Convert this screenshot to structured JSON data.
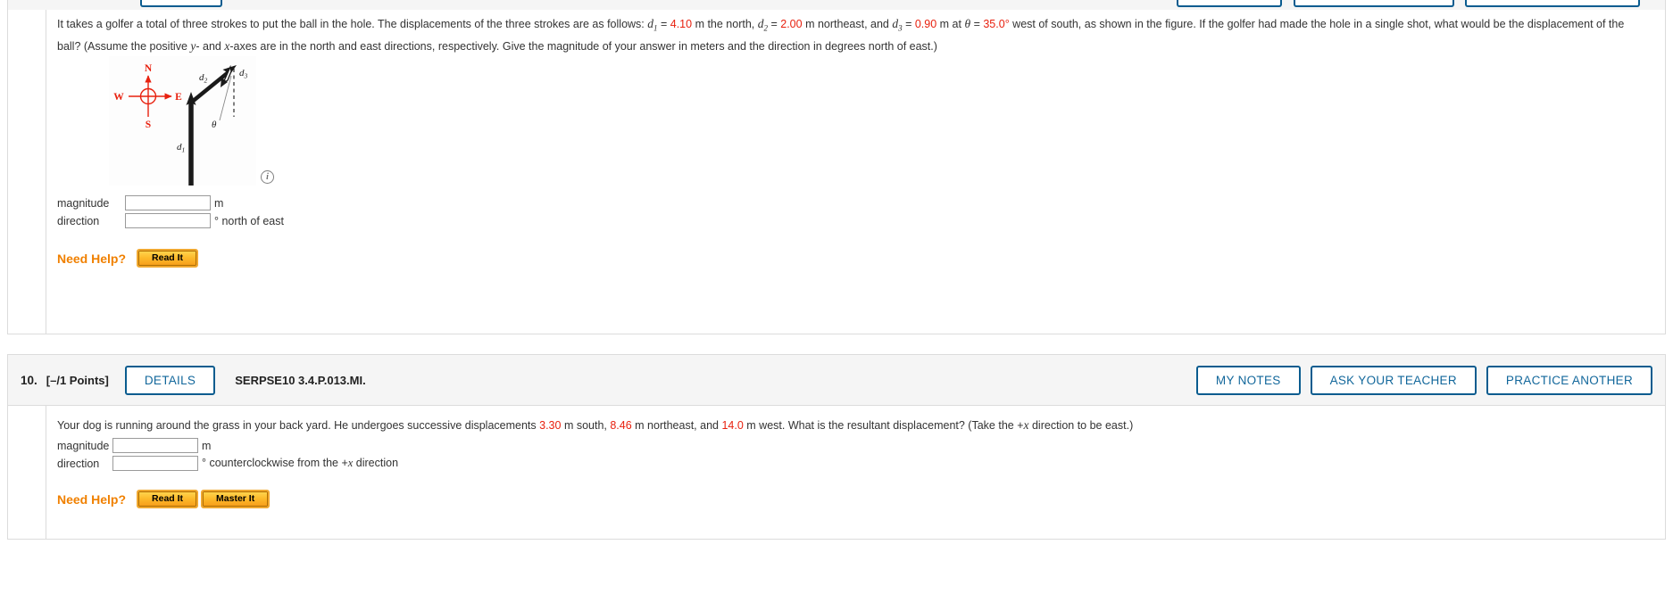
{
  "q9": {
    "problem_text_part1": "It takes a golfer a total of three strokes to put the ball in the hole. The displacements of the three strokes are as follows: ",
    "d1_sym": "d",
    "d1_sub": "1",
    "d1_val": "4.10",
    "after_d1": " m the north, ",
    "d2_sym": "d",
    "d2_sub": "2",
    "d2_val": "2.00",
    "after_d2": " m northeast, and ",
    "d3_sym": "d",
    "d3_sub": "3",
    "d3_val": "0.90",
    "after_d3": " m at ",
    "theta_sym": "θ",
    "theta_eq": " = ",
    "theta_val": "35.0°",
    "after_theta": " west of south, as shown in the figure. If the golfer had made the hole in a single shot, what would be the displacement of the ball? (Assume the positive ",
    "axis_y": "y",
    "axis_mid": "- and ",
    "axis_x": "x",
    "tail": "-axes are in the north and east directions, respectively. Give the magnitude of your answer in meters and the direction in degrees north of east.)",
    "figure": {
      "compass_n": "N",
      "compass_s": "S",
      "compass_e": "E",
      "compass_w": "W",
      "label_d1": "d",
      "label_d1_sub": "1",
      "label_d2": "d",
      "label_d2_sub": "2",
      "label_d3": "d",
      "label_d3_sub": "3",
      "label_theta": "θ",
      "compass_color": "#e8210f",
      "vector_color": "#1a1a1a"
    },
    "info_icon_glyph": "i",
    "answers": [
      {
        "label": "magnitude",
        "value": "",
        "unit": "m"
      },
      {
        "label": "direction",
        "value": "",
        "unit_pre": "° north of east"
      }
    ],
    "need_help_label": "Need Help?",
    "help_buttons": [
      {
        "label": "Read It"
      }
    ]
  },
  "q10": {
    "header": {
      "number": "10.",
      "points": "[–/1 Points]",
      "details_label": "DETAILS",
      "code": "SERPSE10 3.4.P.013.MI.",
      "right_buttons": [
        {
          "label": "MY NOTES"
        },
        {
          "label": "ASK YOUR TEACHER"
        },
        {
          "label": "PRACTICE ANOTHER"
        }
      ]
    },
    "problem_pre": "Your dog is running around the grass in your back yard. He undergoes successive displacements ",
    "v1": "3.30",
    "mid1": " m south, ",
    "v2": "8.46",
    "mid2": " m northeast, and ",
    "v3": "14.0",
    "mid3": " m west. What is the resultant displacement? (Take the +",
    "axis_x": "x",
    "tail": " direction to be east.)",
    "answers": [
      {
        "label": "magnitude",
        "value": "",
        "unit": "m"
      },
      {
        "label": "direction",
        "value": "",
        "unit_pre": "° counterclockwise from the +",
        "unit_x": "x",
        "unit_post": " direction"
      }
    ],
    "need_help_label": "Need Help?",
    "help_buttons": [
      {
        "label": "Read It"
      },
      {
        "label": "Master It"
      }
    ]
  },
  "colors": {
    "accent_blue": "#0a5c8f",
    "value_red": "#e8210f",
    "help_orange": "#f08000"
  }
}
